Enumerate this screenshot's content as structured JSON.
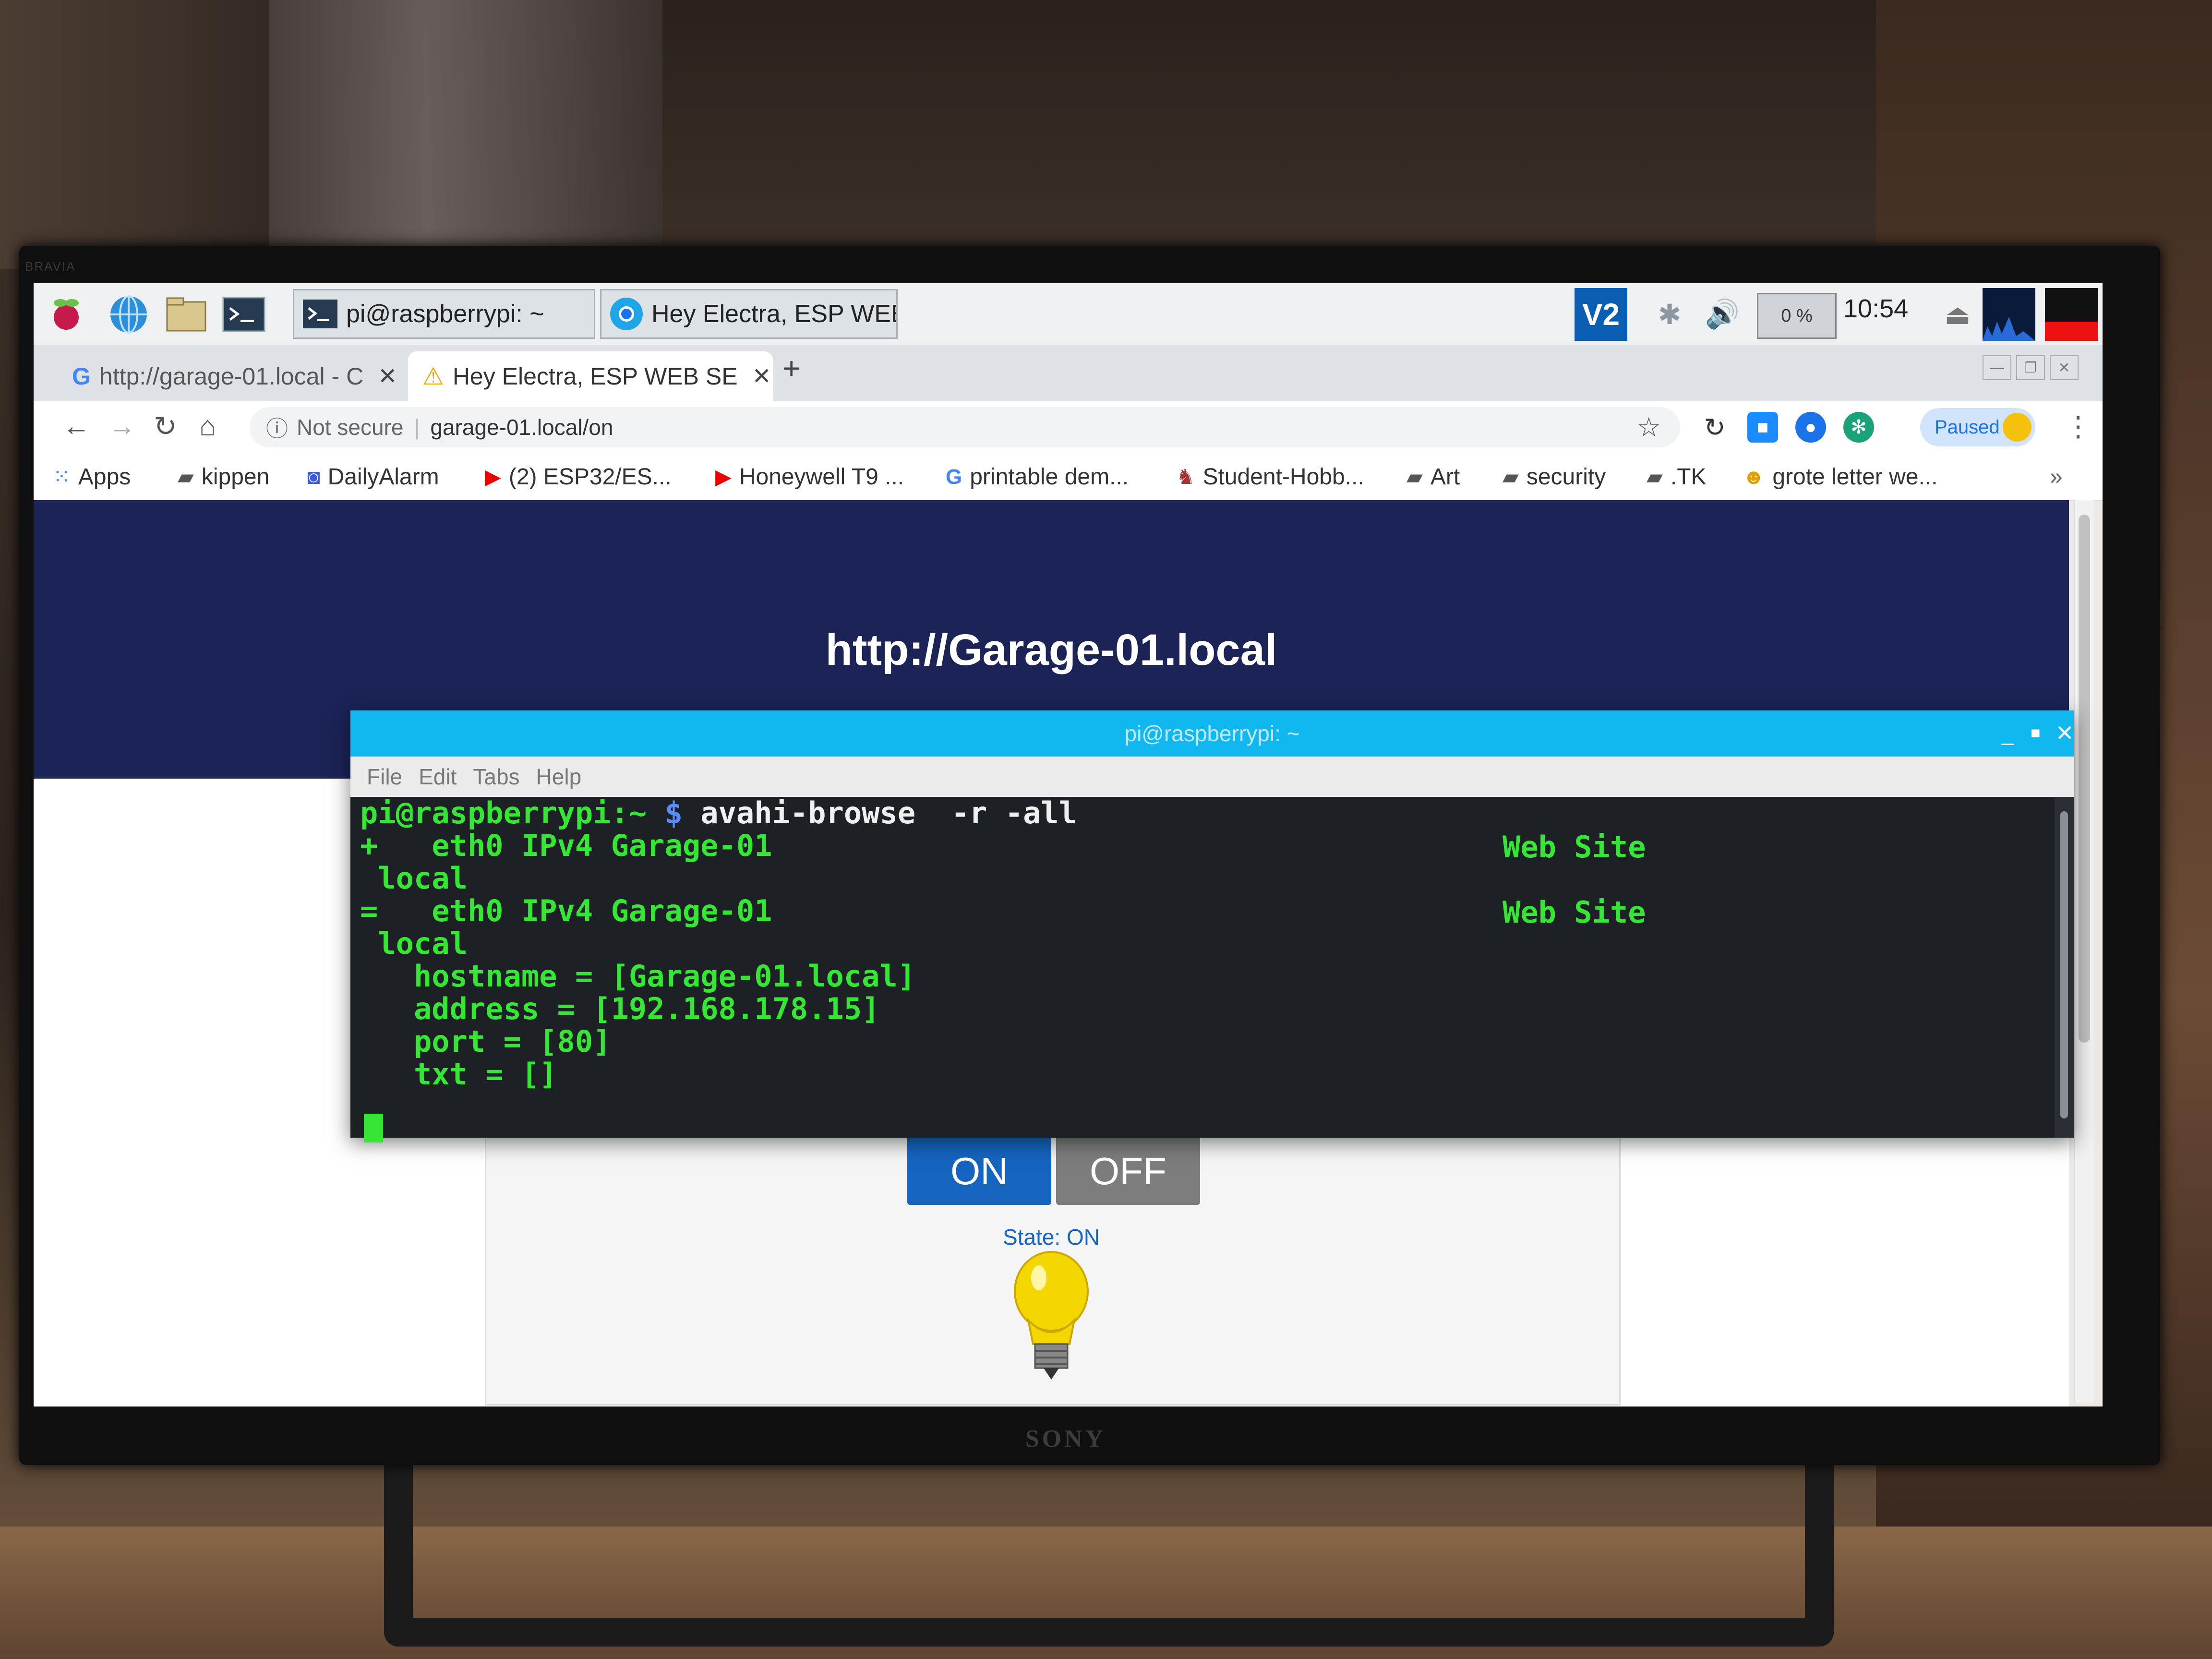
{
  "tv": {
    "top_brand": "BRAVIA",
    "bottom_brand": "SONY"
  },
  "taskbar": {
    "task1": "pi@raspberrypi: ~",
    "task2": "Hey Electra, ESP WEB...",
    "cpu": "0 %",
    "clock": "10:54",
    "icons": [
      "raspberry-menu-icon",
      "web-browser-icon",
      "file-manager-icon",
      "terminal-icon",
      "vnc-icon",
      "bluetooth-icon",
      "volume-icon",
      "cpu-monitor-icon",
      "eject-icon"
    ]
  },
  "browser": {
    "tabs": [
      {
        "label": "http://garage-01.local - C",
        "favicon": "G"
      },
      {
        "label": "Hey Electra, ESP WEB SE",
        "favicon": "⚠"
      }
    ],
    "new_tab": "+",
    "omnibox": {
      "security": "Not secure",
      "url": "garage-01.local/on"
    },
    "profile_status": "Paused",
    "bookmarks": [
      {
        "label": "Apps",
        "icon": "apps-grid-icon"
      },
      {
        "label": "kippen",
        "icon": "folder-icon"
      },
      {
        "label": "DailyAlarm",
        "icon": "alarm-icon"
      },
      {
        "label": "(2) ESP32/ES...",
        "icon": "youtube-icon"
      },
      {
        "label": "Honeywell T9 ...",
        "icon": "youtube-icon"
      },
      {
        "label": "printable dem...",
        "icon": "google-icon"
      },
      {
        "label": "Student-Hobb...",
        "icon": "student-icon"
      },
      {
        "label": "Art",
        "icon": "folder-icon"
      },
      {
        "label": "security",
        "icon": "folder-icon"
      },
      {
        "label": ".TK",
        "icon": "folder-icon"
      },
      {
        "label": "grote letter we...",
        "icon": "emoji-icon"
      }
    ],
    "more_bookmarks": "»"
  },
  "page": {
    "title": "http://Garage-01.local",
    "on_button": "ON",
    "off_button": "OFF",
    "state": "State: ON"
  },
  "terminal": {
    "title": "pi@raspberrypi: ~",
    "menu": [
      "File",
      "Edit",
      "Tabs",
      "Help"
    ],
    "prompt": "pi@raspberrypi:~",
    "dollar": "$",
    "command": "avahi-browse  -r -all",
    "lines": [
      "+   eth0 IPv4 Garage-01",
      " local",
      "=   eth0 IPv4 Garage-01",
      " local",
      "   hostname = [Garage-01.local]",
      "   address = [192.168.178.15]",
      "   port = [80]",
      "   txt = []"
    ],
    "service_type_1": "Web Site",
    "service_type_2": "Web Site"
  },
  "colors": {
    "page_header": "#1b2357",
    "terminal_title": "#10b8ef",
    "terminal_text": "#35e635",
    "on_button": "#1565c0",
    "off_button": "#7d7d7d"
  }
}
